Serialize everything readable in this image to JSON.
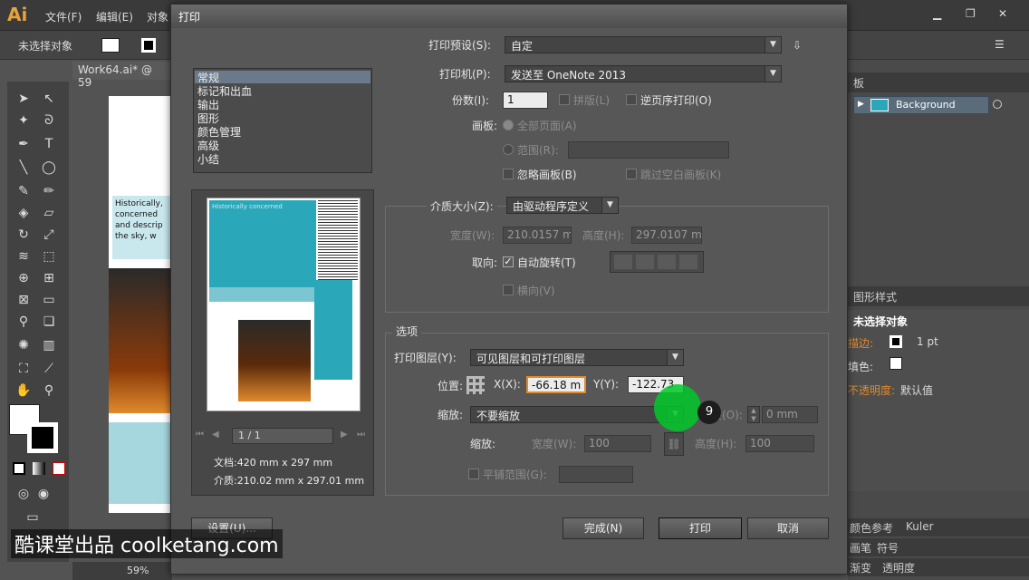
{
  "menubar": {
    "logo": "Ai",
    "items": [
      "文件(F)",
      "编辑(E)",
      "对象"
    ]
  },
  "control_bar": {
    "selection": "未选择对象"
  },
  "document": {
    "tab": "Work64.ai* @ 59",
    "zoom": "59%",
    "artboard_text": "Historically, concerned and descrip the sky, w"
  },
  "right_panels": {
    "layers_header": "板",
    "layer_name": "Background",
    "graphic_styles_header": "图形样式",
    "appearance": {
      "title": "未选择对象",
      "stroke_label": "描边:",
      "stroke_value": "1 pt",
      "fill_label": "填色:",
      "opacity_label": "不透明度:",
      "opacity_value": "默认值"
    },
    "bottom_tabs": [
      "颜色参考",
      "Kuler",
      "画笔",
      "符号",
      "渐变",
      "透明度"
    ]
  },
  "dialog": {
    "title": "打印",
    "preset_label": "打印预设(S):",
    "preset_value": "自定",
    "printer_label": "打印机(P):",
    "printer_value": "发送至 OneNote 2013",
    "copies_label": "份数(I):",
    "copies_value": "1",
    "collate_label": "拼版(L)",
    "reverse_label": "逆页序打印(O)",
    "artboard_label": "画板:",
    "all_pages_label": "全部页面(A)",
    "range_label": "范围(R):",
    "ignore_artboards_label": "忽略画板(B)",
    "skip_blank_label": "跳过空白画板(K)",
    "categories": [
      "常规",
      "标记和出血",
      "输出",
      "图形",
      "颜色管理",
      "高级",
      "小结"
    ],
    "media_size_label": "介质大小(Z):",
    "media_size_value": "由驱动程序定义",
    "width_label": "宽度(W):",
    "width_value": "210.0157 m",
    "height_label": "高度(H):",
    "height_value": "297.0107 m",
    "orientation_label": "取向:",
    "auto_rotate_label": "自动旋转(T)",
    "landscape_label": "横向(V)",
    "options_header": "选项",
    "print_layers_label": "打印图层(Y):",
    "print_layers_value": "可见图层和可打印图层",
    "position_label": "位置:",
    "x_label": "X(X):",
    "x_value": "-66.18 m",
    "y_label": "Y(Y):",
    "y_value": "-122.73",
    "scaling_label": "缩放:",
    "scaling_value": "不要缩放",
    "overlap_label": "叠(O):",
    "overlap_value": "0 mm",
    "scale_label": "缩放:",
    "scale_width_label": "宽度(W):",
    "scale_width_value": "100",
    "scale_height_label": "高度(H):",
    "scale_height_value": "100",
    "tile_range_label": "平铺范围(G):",
    "page_nav": "1 / 1",
    "doc_size": "文档:420 mm x 297 mm",
    "media_size": "介质:210.02 mm x 297.01 mm",
    "preview_text": "Historically concerned",
    "setup_button": "设置(U)...",
    "done_button": "完成(N)",
    "print_button": "打印",
    "cancel_button": "取消"
  },
  "overlay": {
    "badge": "9"
  },
  "watermark": "酷课堂出品 coolketang.com",
  "colors": {
    "accent_orange": "#e08a2c",
    "teal": "#2aa7b9",
    "cursor_green": "#00c828"
  }
}
